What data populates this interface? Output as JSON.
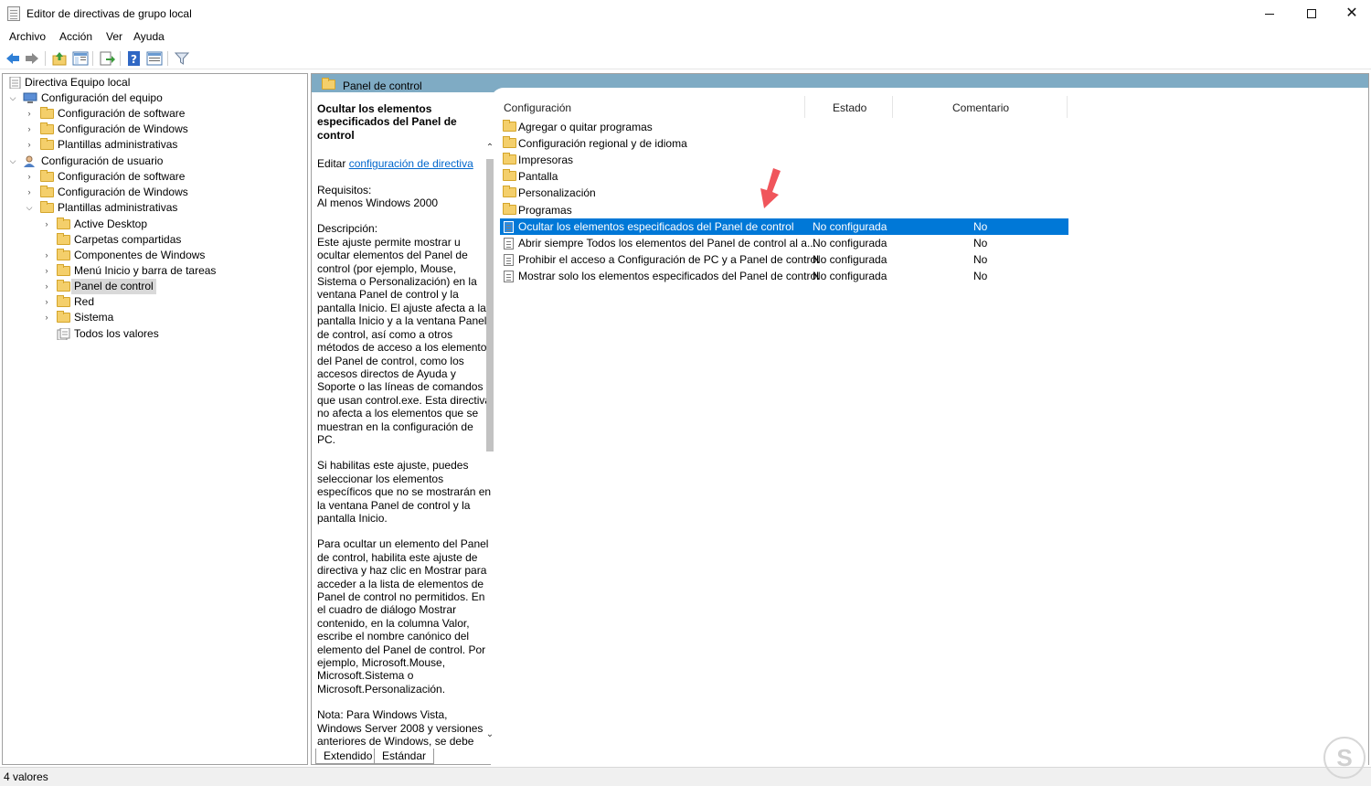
{
  "window": {
    "title": "Editor de directivas de grupo local",
    "controls": {
      "minimize": "minimize-icon",
      "maximize": "maximize-icon",
      "close": "close-icon"
    }
  },
  "menu": [
    "Archivo",
    "Acción",
    "Ver",
    "Ayuda"
  ],
  "toolbar": [
    "back-icon",
    "forward-icon",
    "up-folder-icon",
    "show-hide-tree-icon",
    "export-list-icon",
    "help-icon",
    "properties-icon",
    "filter-icon"
  ],
  "tree": {
    "root": "Directiva Equipo local",
    "equipo": "Configuración del equipo",
    "eq_software": "Configuración de software",
    "eq_windows": "Configuración de Windows",
    "eq_plantillas": "Plantillas administrativas",
    "usuario": "Configuración de usuario",
    "us_software": "Configuración de software",
    "us_windows": "Configuración de Windows",
    "us_plantillas": "Plantillas administrativas",
    "active_desktop": "Active Desktop",
    "carpetas": "Carpetas compartidas",
    "componentes": "Componentes de Windows",
    "menu_inicio": "Menú Inicio y barra de tareas",
    "panel": "Panel de control",
    "red": "Red",
    "sistema": "Sistema",
    "todos": "Todos los valores"
  },
  "header": {
    "title": "Panel de control"
  },
  "description": {
    "title": "Ocultar los elementos especificados del Panel de control",
    "edit_prefix": "Editar ",
    "edit_link": "configuración de directiva",
    "req_label": "Requisitos:",
    "req_value": "Al menos Windows 2000",
    "desc_label": "Descripción:",
    "p1": "Este ajuste permite mostrar u ocultar elementos del Panel de control (por ejemplo, Mouse, Sistema o Personalización) en la ventana Panel de control y la pantalla Inicio. El ajuste afecta a la pantalla Inicio y a la ventana Panel de control, así como a otros métodos de acceso a los elementos del Panel de control, como los accesos directos de Ayuda y Soporte o las líneas de comandos que usan control.exe. Esta directiva no afecta a los elementos que se muestran en la configuración de PC.",
    "p2": "Si habilitas este ajuste, puedes seleccionar los elementos específicos que no se mostrarán en la ventana Panel de control y la pantalla Inicio.",
    "p3": "Para ocultar un elemento del Panel de control, habilita este ajuste de directiva y haz clic en Mostrar para acceder a la lista de elementos de Panel de control no permitidos. En el cuadro de diálogo Mostrar contenido, en la columna Valor, escribe el nombre canónico del elemento del Panel de control. Por ejemplo, Microsoft.Mouse, Microsoft.Sistema o Microsoft.Personalización.",
    "p4": "Nota: Para Windows Vista, Windows Server 2008 y versiones anteriores de Windows, se debe"
  },
  "tabs": {
    "extended": "Extendido",
    "standard": "Estándar"
  },
  "columns": {
    "setting": "Configuración",
    "state": "Estado",
    "comment": "Comentario"
  },
  "folders": [
    "Agregar o quitar programas",
    "Configuración regional y de idioma",
    "Impresoras",
    "Pantalla",
    "Personalización",
    "Programas"
  ],
  "settings": [
    {
      "name": "Ocultar los elementos especificados del Panel de control",
      "state": "No configurada",
      "comment": "No"
    },
    {
      "name": "Abrir siempre Todos los elementos del Panel de control al a...",
      "state": "No configurada",
      "comment": "No"
    },
    {
      "name": "Prohibir el acceso a Configuración de PC y a Panel de control",
      "state": "No configurada",
      "comment": "No"
    },
    {
      "name": "Mostrar solo los elementos especificados del Panel de control",
      "state": "No configurada",
      "comment": "No"
    }
  ],
  "status": {
    "text": "4 valores"
  },
  "colors": {
    "header_band": "#7fabc4",
    "selection": "#0078d7",
    "link": "#0066cc",
    "annotation_arrow": "#f0555b"
  }
}
